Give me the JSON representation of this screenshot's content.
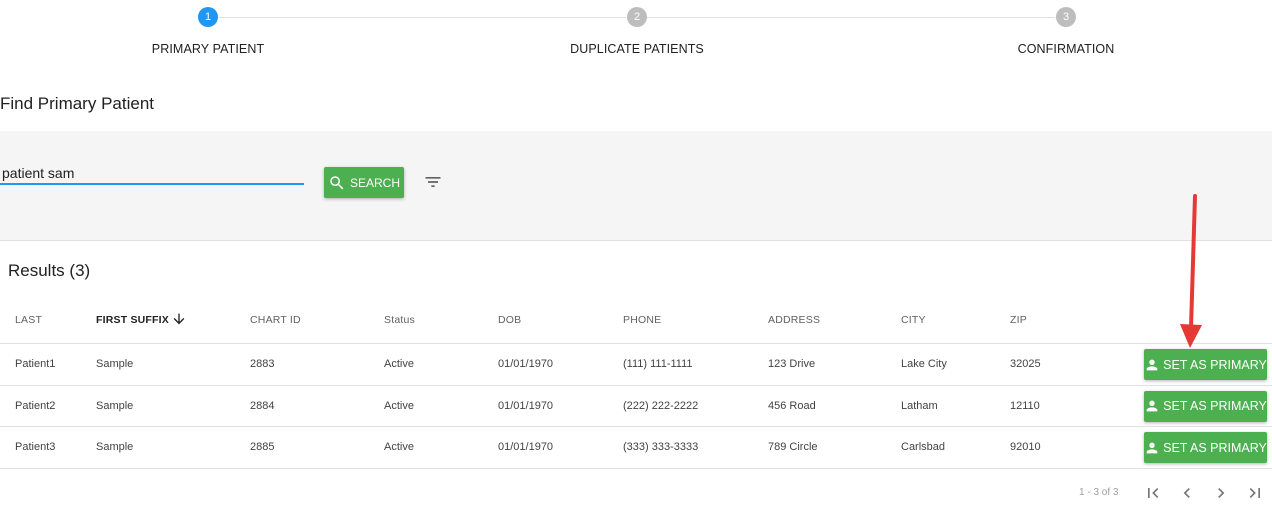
{
  "stepper": {
    "steps": [
      {
        "number": "1",
        "label": "PRIMARY PATIENT",
        "state": "active"
      },
      {
        "number": "2",
        "label": "DUPLICATE PATIENTS",
        "state": "inactive"
      },
      {
        "number": "3",
        "label": "CONFIRMATION",
        "state": "inactive"
      }
    ]
  },
  "page": {
    "title": "Find Primary Patient"
  },
  "search": {
    "value": "patient sam",
    "button_label": "SEARCH",
    "button_icon": "search-icon",
    "filter_icon": "filter-icon"
  },
  "results": {
    "title": "Results (3)",
    "columns": [
      "LAST",
      "FIRST SUFFIX",
      "CHART ID",
      "Status",
      "DOB",
      "PHONE",
      "ADDRESS",
      "CITY",
      "ZIP"
    ],
    "sort_icon": "arrow-down-icon",
    "action_label": "SET AS PRIMARY",
    "action_icon": "person-icon",
    "rows": [
      {
        "last": "Patient1",
        "first": "Sample",
        "chart_id": "2883",
        "status": "Active",
        "dob": "01/01/1970",
        "phone": "(111) 111-1111",
        "address": "123 Drive",
        "city": "Lake City",
        "zip": "32025"
      },
      {
        "last": "Patient2",
        "first": "Sample",
        "chart_id": "2884",
        "status": "Active",
        "dob": "01/01/1970",
        "phone": "(222) 222-2222",
        "address": "456 Road",
        "city": "Latham",
        "zip": "12110"
      },
      {
        "last": "Patient3",
        "first": "Sample",
        "chart_id": "2885",
        "status": "Active",
        "dob": "01/01/1970",
        "phone": "(333) 333-3333",
        "address": "789 Circle",
        "city": "Carlsbad",
        "zip": "92010"
      }
    ]
  },
  "pagination": {
    "range": "1 - 3 of 3",
    "icons": [
      "first-page-icon",
      "previous-page-icon",
      "next-page-icon",
      "last-page-icon"
    ]
  },
  "colors": {
    "accent": "#2196f3",
    "button": "#4caf50",
    "annotation": "#e53935"
  }
}
